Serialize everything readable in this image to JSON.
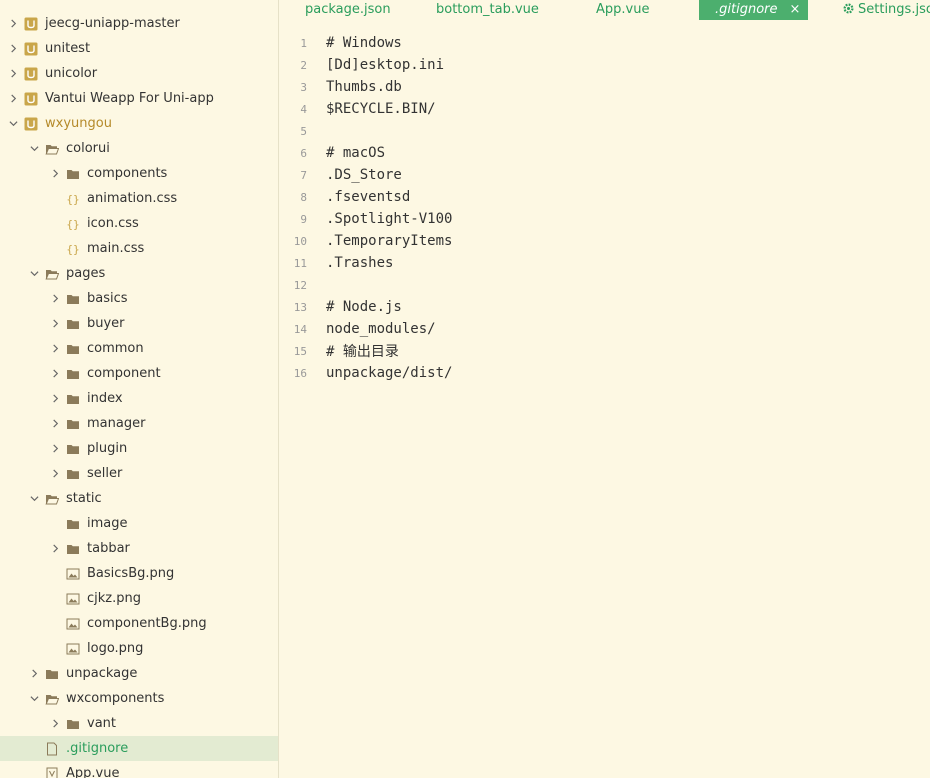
{
  "sidebar": {
    "rows": [
      {
        "label": "jeecg-uniapp-master",
        "type": "project",
        "expanded": false,
        "depth": 0
      },
      {
        "label": "unitest",
        "type": "project",
        "expanded": false,
        "depth": 0
      },
      {
        "label": "unicolor",
        "type": "project",
        "expanded": false,
        "depth": 0
      },
      {
        "label": "Vantui Weapp For Uni-app",
        "type": "project",
        "expanded": false,
        "depth": 0
      },
      {
        "label": "wxyungou",
        "type": "project",
        "expanded": true,
        "depth": 0,
        "open": true
      },
      {
        "label": "colorui",
        "type": "folder",
        "expanded": true,
        "depth": 1
      },
      {
        "label": "components",
        "type": "folder",
        "expanded": false,
        "depth": 2
      },
      {
        "label": "animation.css",
        "type": "css",
        "depth": 2
      },
      {
        "label": "icon.css",
        "type": "css",
        "depth": 2
      },
      {
        "label": "main.css",
        "type": "css",
        "depth": 2
      },
      {
        "label": "pages",
        "type": "folder",
        "expanded": true,
        "depth": 1
      },
      {
        "label": "basics",
        "type": "folder",
        "expanded": false,
        "depth": 2
      },
      {
        "label": "buyer",
        "type": "folder",
        "expanded": false,
        "depth": 2
      },
      {
        "label": "common",
        "type": "folder",
        "expanded": false,
        "depth": 2
      },
      {
        "label": "component",
        "type": "folder",
        "expanded": false,
        "depth": 2
      },
      {
        "label": "index",
        "type": "folder",
        "expanded": false,
        "depth": 2
      },
      {
        "label": "manager",
        "type": "folder",
        "expanded": false,
        "depth": 2
      },
      {
        "label": "plugin",
        "type": "folder",
        "expanded": false,
        "depth": 2
      },
      {
        "label": "seller",
        "type": "folder",
        "expanded": false,
        "depth": 2
      },
      {
        "label": "static",
        "type": "folder",
        "expanded": true,
        "depth": 1
      },
      {
        "label": "image",
        "type": "folder-empty",
        "depth": 2
      },
      {
        "label": "tabbar",
        "type": "folder",
        "expanded": false,
        "depth": 2
      },
      {
        "label": "BasicsBg.png",
        "type": "image",
        "depth": 2
      },
      {
        "label": "cjkz.png",
        "type": "image",
        "depth": 2
      },
      {
        "label": "componentBg.png",
        "type": "image",
        "depth": 2
      },
      {
        "label": "logo.png",
        "type": "image",
        "depth": 2
      },
      {
        "label": "unpackage",
        "type": "folder",
        "expanded": false,
        "depth": 1
      },
      {
        "label": "wxcomponents",
        "type": "folder",
        "expanded": true,
        "depth": 1
      },
      {
        "label": "vant",
        "type": "folder",
        "expanded": false,
        "depth": 2
      },
      {
        "label": ".gitignore",
        "type": "file",
        "depth": 1,
        "selected": true
      },
      {
        "label": "App.vue",
        "type": "vue",
        "depth": 1
      }
    ]
  },
  "tabs": [
    {
      "label": "package.json",
      "active": false
    },
    {
      "label": "bottom_tab.vue",
      "active": false
    },
    {
      "label": "App.vue",
      "active": false
    },
    {
      "label": ".gitignore",
      "active": true,
      "close": "×"
    },
    {
      "label": "Settings.json",
      "active": false,
      "icon": "gear-icon"
    }
  ],
  "editor": {
    "lines": [
      {
        "n": "1",
        "text": "# Windows"
      },
      {
        "n": "2",
        "text": "[Dd]esktop.ini"
      },
      {
        "n": "3",
        "text": "Thumbs.db"
      },
      {
        "n": "4",
        "text": "$RECYCLE.BIN/"
      },
      {
        "n": "5",
        "text": ""
      },
      {
        "n": "6",
        "text": "# macOS"
      },
      {
        "n": "7",
        "text": ".DS_Store"
      },
      {
        "n": "8",
        "text": ".fseventsd"
      },
      {
        "n": "9",
        "text": ".Spotlight-V100"
      },
      {
        "n": "10",
        "text": ".TemporaryItems"
      },
      {
        "n": "11",
        "text": ".Trashes"
      },
      {
        "n": "12",
        "text": ""
      },
      {
        "n": "13",
        "text": "# Node.js"
      },
      {
        "n": "14",
        "text": "node_modules/"
      },
      {
        "n": "15",
        "text": "# 输出目录"
      },
      {
        "n": "16",
        "text": "unpackage/dist/"
      }
    ]
  },
  "colors": {
    "accent": "#4caf6e",
    "background": "#fdf8e3",
    "selected_row": "#e3ebd2",
    "tab_text": "#2a9d5c"
  }
}
